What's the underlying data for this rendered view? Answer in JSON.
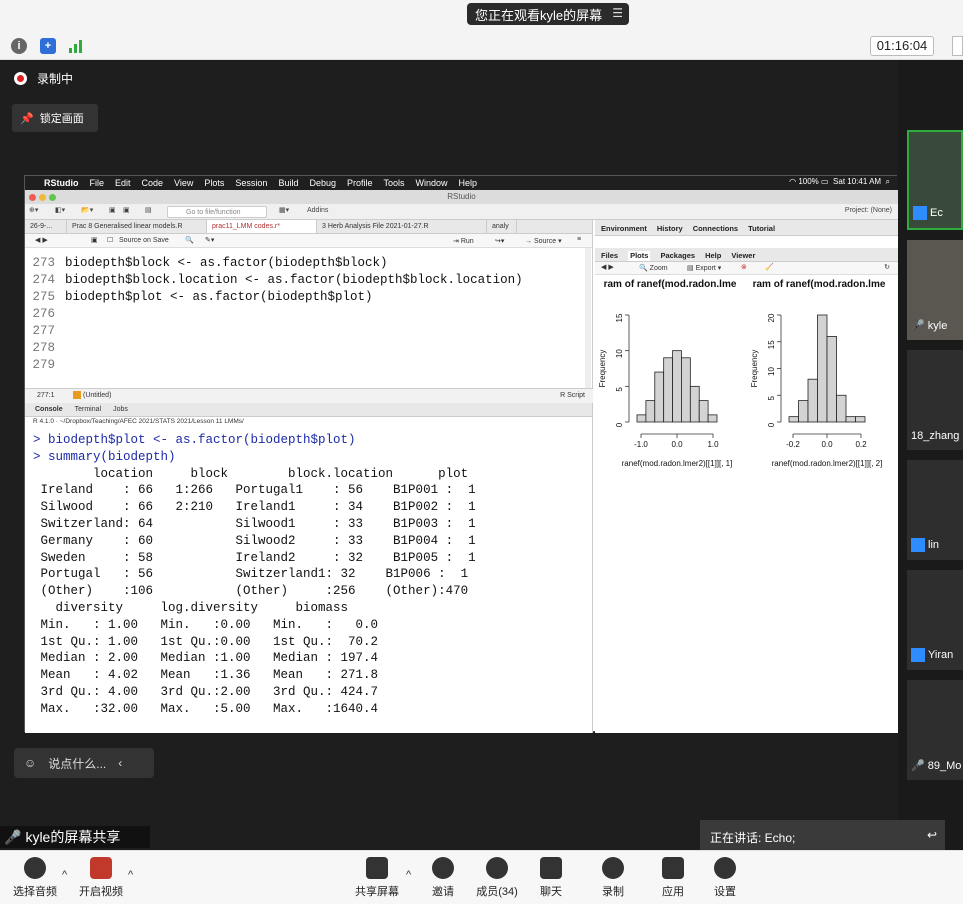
{
  "zoom": {
    "share_banner": "您正在观看kyle的屏幕",
    "timer": "01:16:04",
    "recording": "录制中",
    "lock_screen": "锁定画面",
    "chat_placeholder": "说点什么...",
    "share_label": "kyle的屏幕共享",
    "speaking": "正在讲话: Echo;",
    "participants": [
      "Ec",
      "kyle",
      "18_zhang",
      "lin",
      "Yiran",
      "89_Mo"
    ],
    "toolbar": {
      "audio": "选择音频",
      "video": "开启视频",
      "share": "共享屏幕",
      "invite": "邀请",
      "members": "成员(34)",
      "chat": "聊天",
      "record": "录制",
      "apps": "应用",
      "settings": "设置"
    }
  },
  "rstudio": {
    "mac_menu": [
      "RStudio",
      "File",
      "Edit",
      "Code",
      "View",
      "Plots",
      "Session",
      "Build",
      "Debug",
      "Profile",
      "Tools",
      "Window",
      "Help"
    ],
    "mac_time": "Sat 10:41 AM",
    "mac_battery": "100%",
    "window_title": "RStudio",
    "goto_placeholder": "Go to file/function",
    "addins": "Addins",
    "project": "Project: (None)",
    "editor_tabs": [
      "26-9-...",
      "Prac 8 Generalised linear models.R",
      "prac11_LMM codes.r*",
      "3 Herb Analysis File 2021-01-27.R",
      "analy"
    ],
    "source_on_save": "Source on Save",
    "run": "Run",
    "source": "Source",
    "code_lines": [
      {
        "n": "273",
        "text": "biodepth$block <- as.factor(biodepth$block)"
      },
      {
        "n": "274",
        "text": "biodepth$block.location <- as.factor(biodepth$block.location)"
      },
      {
        "n": "275",
        "text": "biodepth$plot <- as.factor(biodepth$plot)"
      },
      {
        "n": "276",
        "text": ""
      },
      {
        "n": "277",
        "text": ""
      },
      {
        "n": "278",
        "text": ""
      },
      {
        "n": "279",
        "text": ""
      }
    ],
    "cursor_pos": "277:1",
    "untitled": "(Untitled)",
    "script_type": "R Script",
    "console_tabs": [
      "Console",
      "Terminal",
      "Jobs"
    ],
    "console_path": "R 4.1.0 · ~/Dropbox/Teaching/AFEC 2021/STATS 2021/Lesson 11 LMMs/",
    "console_lines": [
      {
        "text": "> biodepth$plot <- as.factor(biodepth$plot)",
        "blue": true
      },
      {
        "text": "> summary(biodepth)",
        "blue": true
      },
      {
        "text": "        location     block        block.location      plot    ",
        "blue": false
      },
      {
        "text": " Ireland    : 66   1:266   Portugal1    : 56    B1P001 :  1  ",
        "blue": false
      },
      {
        "text": " Silwood    : 66   2:210   Ireland1     : 34    B1P002 :  1  ",
        "blue": false
      },
      {
        "text": " Switzerland: 64           Silwood1     : 33    B1P003 :  1  ",
        "blue": false
      },
      {
        "text": " Germany    : 60           Silwood2     : 33    B1P004 :  1  ",
        "blue": false
      },
      {
        "text": " Sweden     : 58           Ireland2     : 32    B1P005 :  1  ",
        "blue": false
      },
      {
        "text": " Portugal   : 56           Switzerland1: 32    B1P006 :  1  ",
        "blue": false
      },
      {
        "text": " (Other)    :106           (Other)     :256    (Other):470  ",
        "blue": false
      },
      {
        "text": "   diversity     log.diversity     biomass      ",
        "blue": false
      },
      {
        "text": " Min.   : 1.00   Min.   :0.00   Min.   :   0.0  ",
        "blue": false
      },
      {
        "text": " 1st Qu.: 1.00   1st Qu.:0.00   1st Qu.:  70.2  ",
        "blue": false
      },
      {
        "text": " Median : 2.00   Median :1.00   Median : 197.4  ",
        "blue": false
      },
      {
        "text": " Mean   : 4.02   Mean   :1.36   Mean   : 271.8  ",
        "blue": false
      },
      {
        "text": " 3rd Qu.: 4.00   3rd Qu.:2.00   3rd Qu.: 424.7  ",
        "blue": false
      },
      {
        "text": " Max.   :32.00   Max.   :5.00   Max.   :1640.4  ",
        "blue": false
      }
    ],
    "env_tabs": [
      "Environment",
      "History",
      "Connections",
      "Tutorial"
    ],
    "file_tabs": [
      "Files",
      "Plots",
      "Packages",
      "Help",
      "Viewer"
    ],
    "zoom_label": "Zoom",
    "export_label": "Export",
    "plots": [
      {
        "title": "ram of ranef(mod.radon.lme",
        "xlabel": "ranef(mod.radon.lmer2)[[1]][, 1]",
        "ylabel": "Frequency",
        "xticks": [
          "-1.0",
          "0.0",
          "1.0"
        ],
        "yticks": [
          "0",
          "5",
          "10",
          "15"
        ],
        "ymax": 15,
        "bars": [
          1,
          3,
          7,
          9,
          10,
          9,
          5,
          3,
          1
        ]
      },
      {
        "title": "ram of ranef(mod.radon.lme",
        "xlabel": "ranef(mod.radon.lmer2)[[1]][, 2]",
        "ylabel": "Frequency",
        "xticks": [
          "-0.2",
          "0.0",
          "0.2"
        ],
        "yticks": [
          "0",
          "5",
          "10",
          "15",
          "20"
        ],
        "ymax": 20,
        "bars": [
          1,
          4,
          8,
          20,
          16,
          5,
          1,
          1
        ]
      }
    ]
  }
}
